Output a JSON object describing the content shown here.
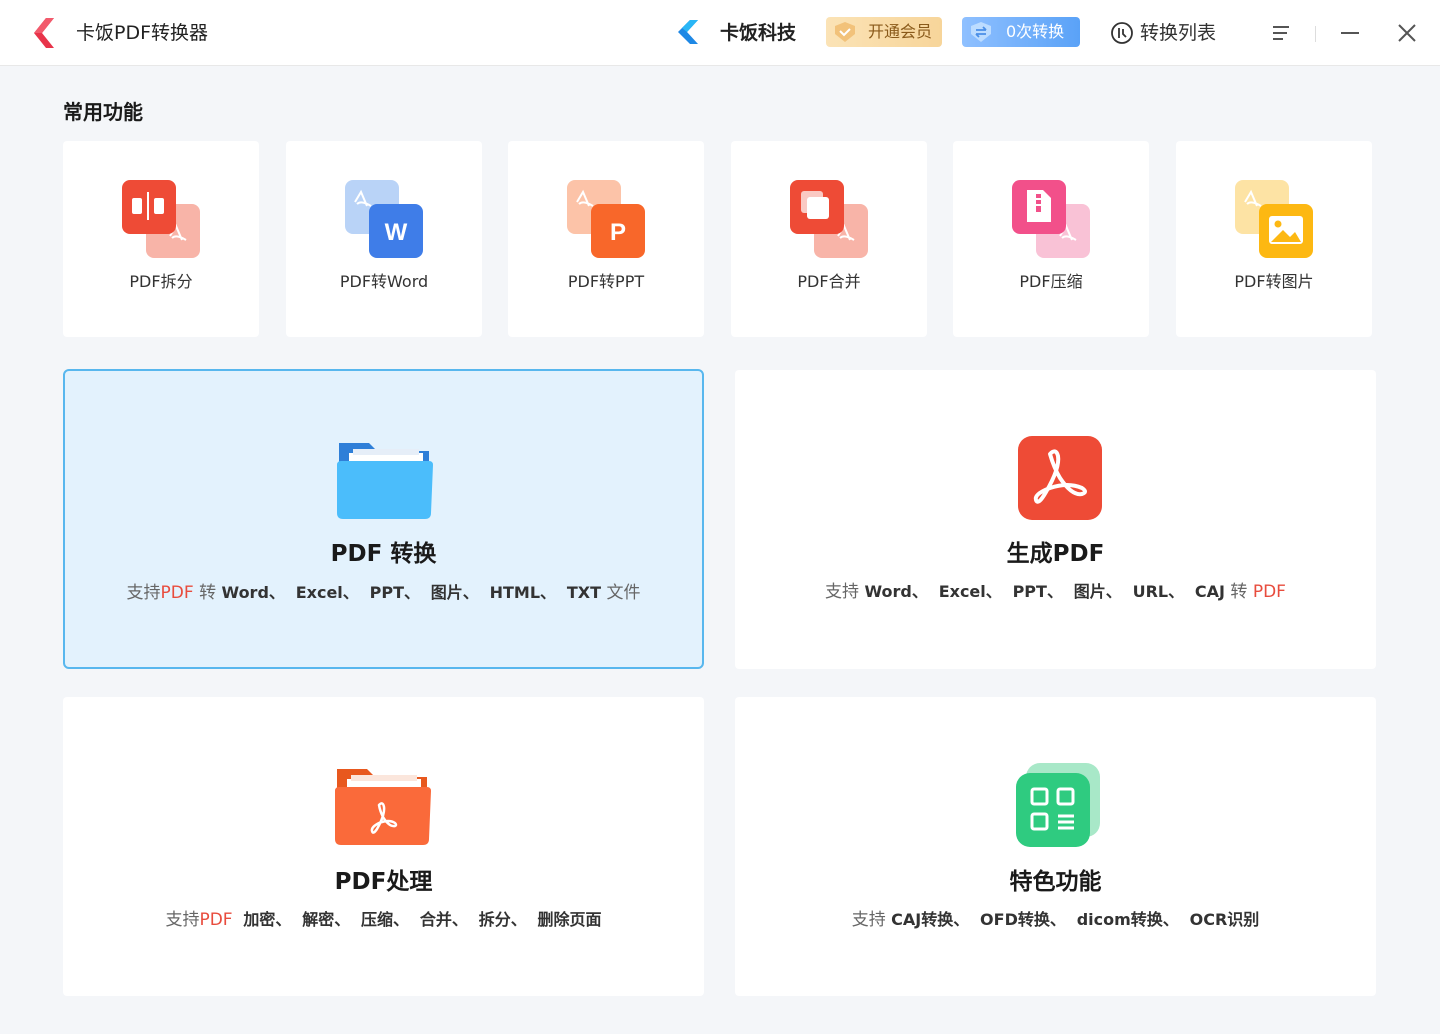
{
  "app": {
    "title": "卡饭PDF转换器",
    "brand": "卡饭科技"
  },
  "header": {
    "vip_label": "开通会员",
    "convert_count_label": "0次转换",
    "list_label": "转换列表"
  },
  "section": {
    "title": "常用功能"
  },
  "tools": [
    {
      "label": "PDF拆分",
      "icon": "pdf-split-icon"
    },
    {
      "label": "PDF转Word",
      "icon": "pdf-to-word-icon"
    },
    {
      "label": "PDF转PPT",
      "icon": "pdf-to-ppt-icon"
    },
    {
      "label": "PDF合并",
      "icon": "pdf-merge-icon"
    },
    {
      "label": "PDF压缩",
      "icon": "pdf-compress-icon"
    },
    {
      "label": "PDF转图片",
      "icon": "pdf-to-image-icon"
    }
  ],
  "cards": {
    "convert": {
      "title": "PDF 转换",
      "d1": "支持",
      "d2": "PDF",
      "d3": "转",
      "d4": "Word、",
      "d5": "Excel、",
      "d6": "PPT、",
      "d7": "图片、",
      "d8": "HTML、",
      "d9": "TXT",
      "d10": "文件"
    },
    "create": {
      "title": "生成PDF",
      "d1": "支持",
      "d2": "Word、",
      "d3": "Excel、",
      "d4": "PPT、",
      "d5": "图片、",
      "d6": "URL、",
      "d7": "CAJ",
      "d8": "转",
      "d9": "PDF"
    },
    "process": {
      "title": "PDF处理",
      "d1": "支持",
      "d2": "PDF",
      "d3": "加密、",
      "d4": "解密、",
      "d5": "压缩、",
      "d6": "合并、",
      "d7": "拆分、",
      "d8": "删除页面"
    },
    "special": {
      "title": "特色功能",
      "d1": "支持",
      "d2": "CAJ转换、",
      "d3": "OFD转换、",
      "d4": "dicom转换、",
      "d5": "OCR识别"
    }
  },
  "colors": {
    "accent": "#58b7ee",
    "active_bg": "#e3f2fd",
    "red": "#e84c3d",
    "page_bg": "#f4f6f9"
  }
}
